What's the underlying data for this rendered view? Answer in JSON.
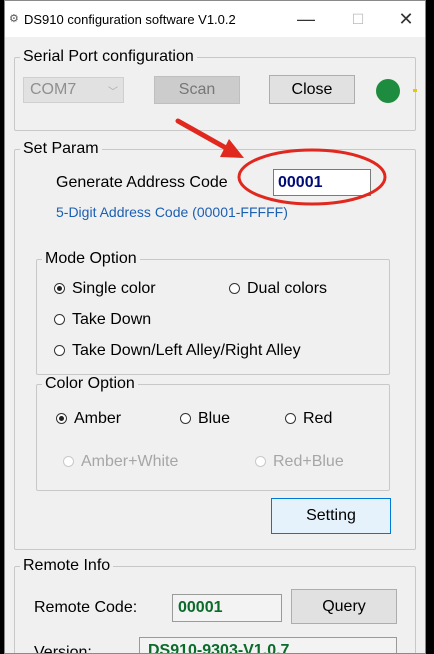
{
  "window": {
    "title": "DS910 configuration software V1.0.2",
    "minimize": "—",
    "maximize": "☐",
    "close": "✕"
  },
  "serial": {
    "legend": "Serial Port configuration",
    "port": "COM7",
    "scan_label": "Scan",
    "close_label": "Close",
    "status_color": "#1e8c3e"
  },
  "set_param": {
    "legend": "Set Param",
    "address_label": "Generate Address Code",
    "address_value": "00001",
    "address_hint": "5-Digit Address Code (00001-FFFFF)",
    "mode": {
      "legend": "Mode Option",
      "options": [
        "Single color",
        "Dual colors",
        "Take Down",
        "Take Down/Left Alley/Right Alley"
      ],
      "selected": "Single color"
    },
    "color": {
      "legend": "Color Option",
      "options": [
        "Amber",
        "Blue",
        "Red",
        "Amber+White",
        "Red+Blue"
      ],
      "selected": "Amber"
    },
    "setting_label": "Setting"
  },
  "remote": {
    "legend": "Remote Info",
    "code_label": "Remote Code:",
    "code_value": "00001",
    "query_label": "Query",
    "version_label": "Version:",
    "version_value": "DS910-9303-V1.0.7"
  },
  "annotation": {
    "color": "#e0281e"
  }
}
